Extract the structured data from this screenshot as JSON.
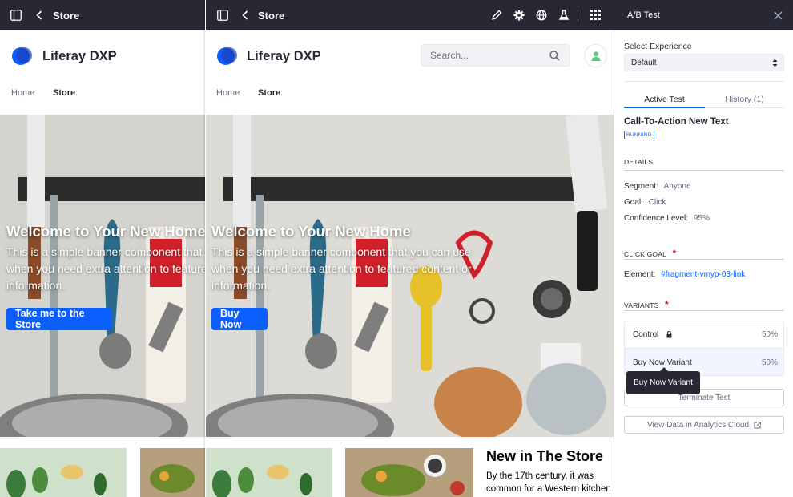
{
  "left_frame": {
    "title": "Store",
    "logo_text": "Liferay DXP",
    "nav": [
      "Home",
      "Store"
    ],
    "hero": {
      "title": "Welcome to Your New Home",
      "body": "This is a simple banner component that you can use when you need extra attention to featured content or information.",
      "button": "Take me to the Store"
    }
  },
  "main_frame": {
    "title": "Store",
    "logo_text": "Liferay DXP",
    "search_placeholder": "Search...",
    "nav": [
      "Home",
      "Store"
    ],
    "hero": {
      "title": "Welcome to Your New Home",
      "body": "This is a simple banner component that you can use when you need extra attention to featured content or information.",
      "button": "Buy Now"
    },
    "feature": {
      "title": "New in The Store",
      "body": "By the 17th century, it was common for a Western kitchen"
    }
  },
  "panel": {
    "title": "A/B Test",
    "select_label": "Select Experience",
    "select_value": "Default",
    "tabs": [
      "Active Test",
      "History (1)"
    ],
    "active_tab_index": 0,
    "test_name": "Call-To-Action New Text",
    "status_badge": "RUNNING",
    "details_header": "DETAILS",
    "segment_label": "Segment:",
    "segment_value": "Anyone",
    "goal_label": "Goal:",
    "goal_value": "Click",
    "confidence_label": "Confidence Level:",
    "confidence_value": "95%",
    "click_goal_header": "CLICK GOAL",
    "required_mark": "*",
    "element_label": "Element:",
    "element_value": "#fragment-vmyp-03-link",
    "variants_header": "VARIANTS",
    "variants": [
      {
        "name": "Control",
        "pct": "50%",
        "locked": true
      },
      {
        "name": "Buy Now Variant",
        "pct": "50%",
        "locked": false
      }
    ],
    "tooltip": "Buy Now Variant",
    "terminate_button": "Terminate Test",
    "view_data_button": "View Data in Analytics Cloud"
  },
  "colors": {
    "topbar": "#272833",
    "accent": "#0b5fff",
    "panel_link": "#0b5fff"
  }
}
